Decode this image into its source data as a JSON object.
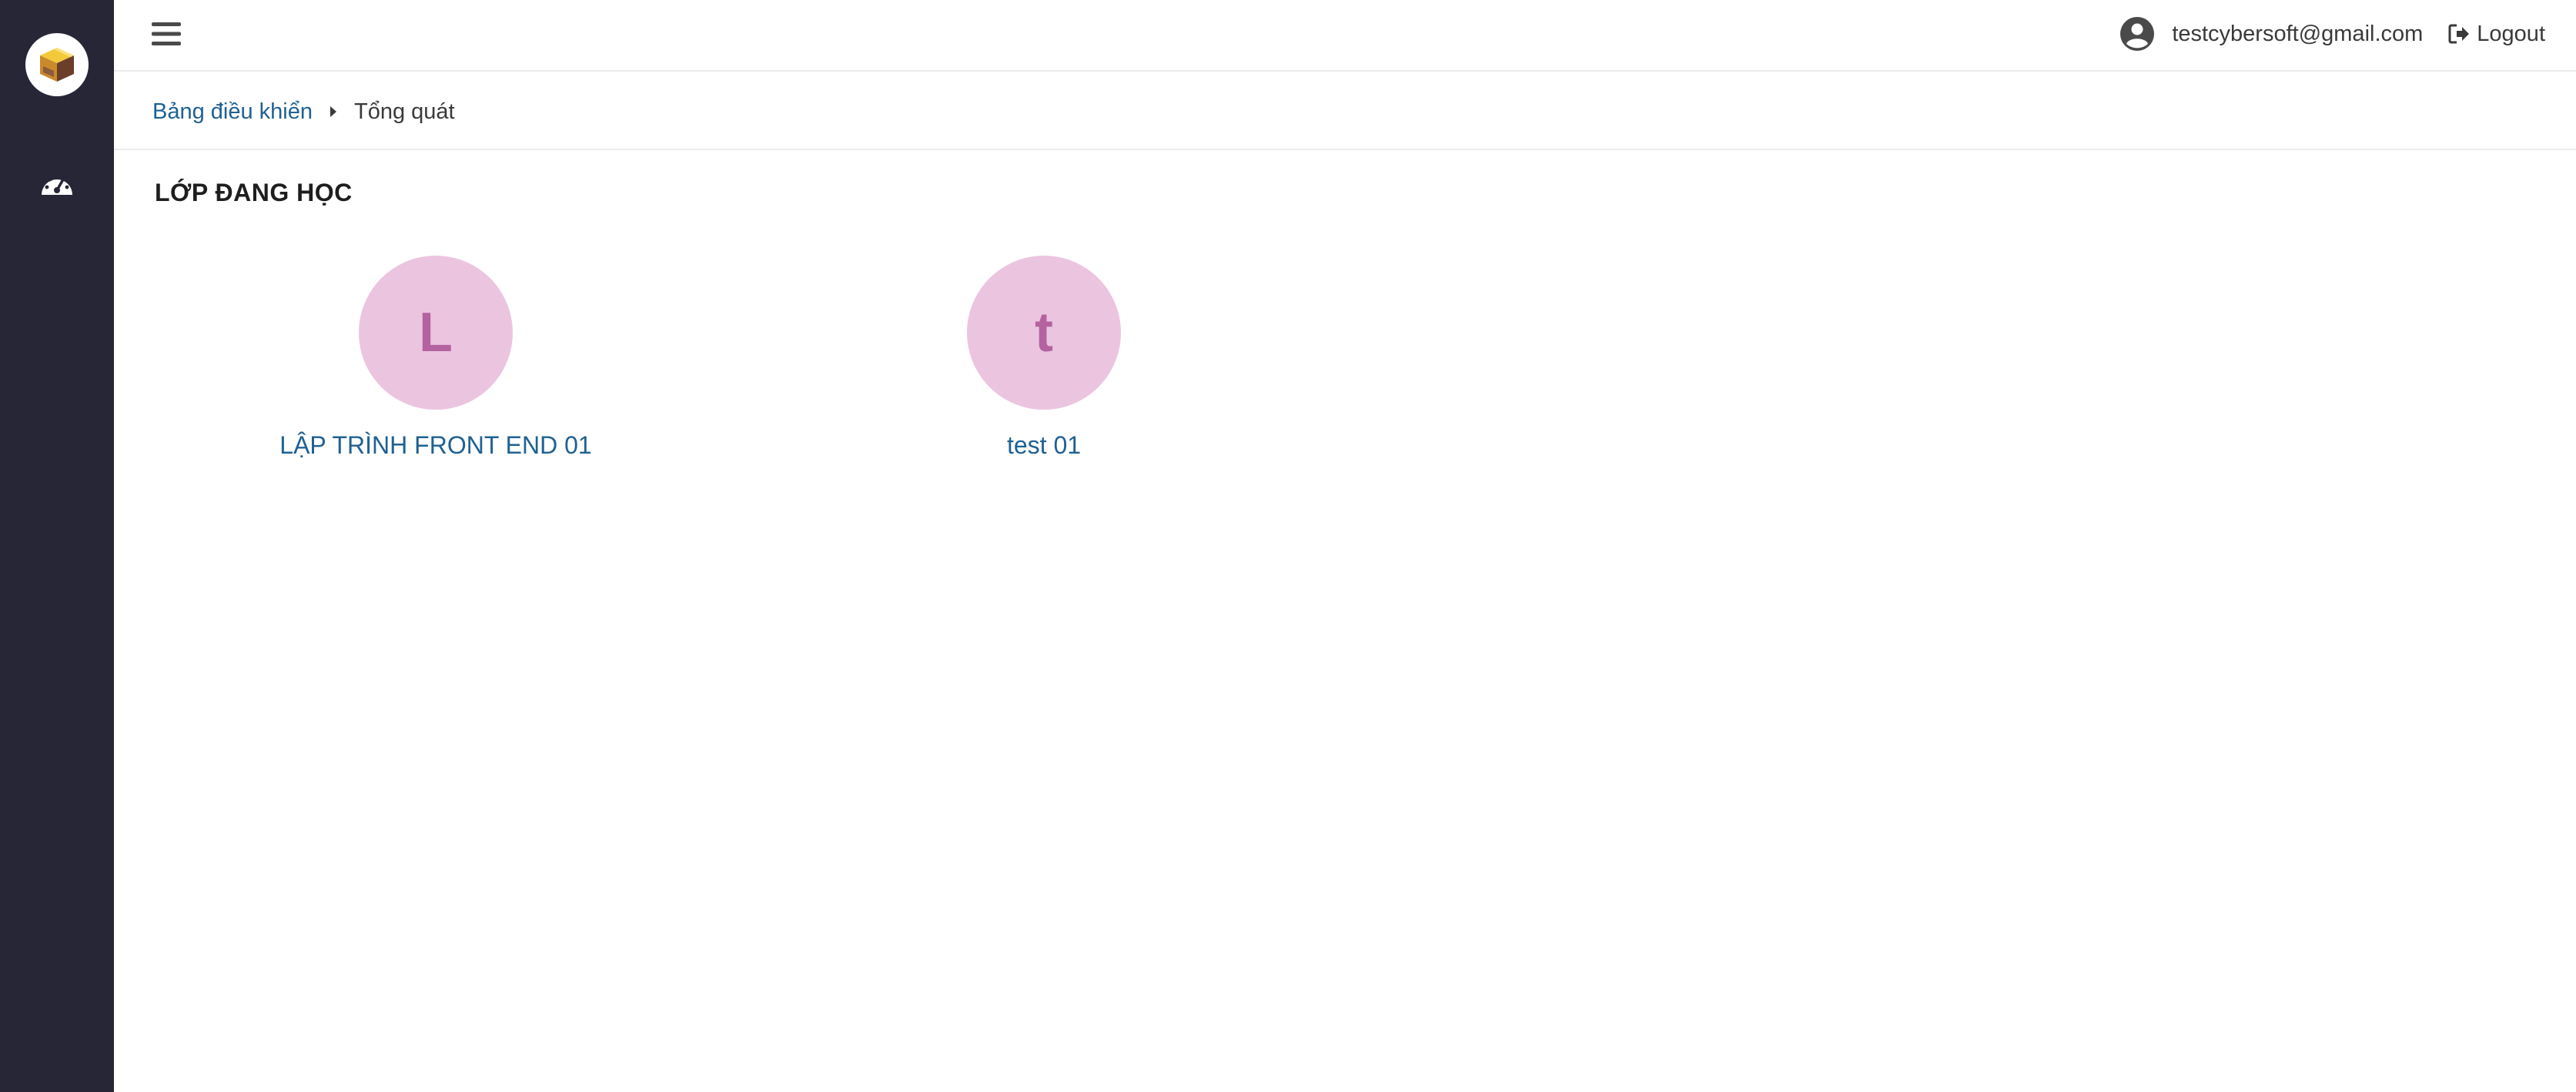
{
  "sidebar": {
    "logo_icon": "box-logo-icon",
    "items": [
      {
        "icon": "dashboard-gauge-icon"
      }
    ]
  },
  "header": {
    "menu_icon": "hamburger-icon",
    "user_icon": "user-circle-icon",
    "user_email": "testcybersoft@gmail.com",
    "logout_icon": "sign-out-icon",
    "logout_label": "Logout"
  },
  "breadcrumb": {
    "items": [
      {
        "label": "Bảng điều khiển"
      },
      {
        "label": "Tổng quát"
      }
    ],
    "separator_icon": "caret-right-icon"
  },
  "main": {
    "section_title": "LỚP ĐANG HỌC",
    "classes": [
      {
        "initial": "L",
        "name": "LẬP TRÌNH FRONT END 01"
      },
      {
        "initial": "t",
        "name": "test 01"
      }
    ]
  },
  "colors": {
    "sidebar_bg": "#262637",
    "link": "#1f6192",
    "avatar_bg": "#ebc5e0",
    "avatar_text": "#b462a0"
  }
}
